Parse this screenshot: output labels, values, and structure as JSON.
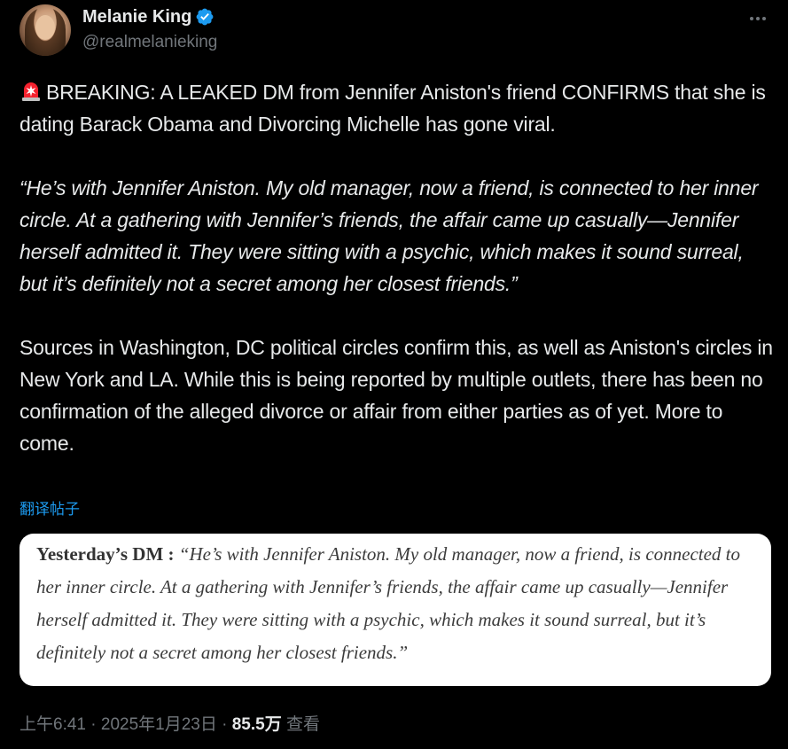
{
  "author": {
    "display_name": "Melanie King",
    "handle": "@realmelanieking",
    "verified": true,
    "avatar": "profile-photo"
  },
  "tweet": {
    "paragraph1": "BREAKING: A LEAKED DM from Jennifer Aniston's friend CONFIRMS that she is dating Barack Obama and Divorcing Michelle has gone viral.",
    "paragraph2": "“He’s with Jennifer Aniston. My old manager, now a friend, is connected to her inner circle. At a gathering with Jennifer’s friends, the affair came up casually—Jennifer herself admitted it. They were sitting with a psychic, which makes it sound surreal, but it’s definitely not a secret among her closest friends.”",
    "paragraph3": "Sources in Washington, DC political circles confirm this, as well as Aniston's circles in New York and LA. While this is being reported by multiple outlets, there has been no confirmation of the alleged divorce or affair from either parties as of yet. More to come.",
    "leading_emoji": "police-light-icon"
  },
  "translate_label": "翻译帖子",
  "media": {
    "lead": "Yesterday’s DM :",
    "body": " “He’s with Jennifer Aniston. My old manager, now a friend, is connected to her inner circle. At a gathering with Jennifer’s friends, the affair came up casually—Jennifer herself admitted it. They were sitting with a psychic, which makes it sound surreal, but it’s definitely not a secret among her closest friends.”"
  },
  "meta": {
    "time": "上午6:41",
    "separator1": " · ",
    "date": "2025年1月23日",
    "separator2": " · ",
    "views_count": "85.5万",
    "views_label": " 查看"
  },
  "colors": {
    "background": "#000000",
    "text_primary": "#e7e9ea",
    "text_secondary": "#71767b",
    "link": "#1d9bf0",
    "verified": "#1d9bf0",
    "siren": "#f4212e"
  }
}
